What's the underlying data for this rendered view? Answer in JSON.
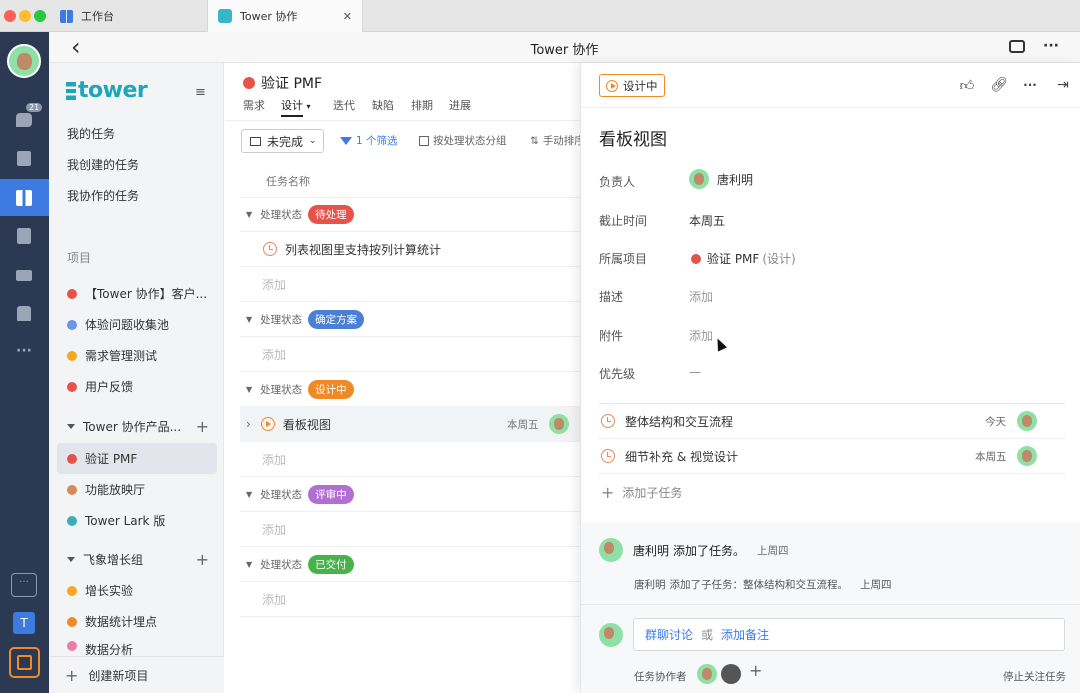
{
  "tabs": {
    "workspace": "工作台",
    "active": "Tower 协作",
    "close": "✕"
  },
  "titlebar": {
    "back": "‹",
    "title": "Tower 协作",
    "more": "···"
  },
  "rail": {
    "badge": "21"
  },
  "sidebar": {
    "logo": "tower",
    "my_tasks": "我的任务",
    "created_tasks": "我创建的任务",
    "collab_tasks": "我协作的任务",
    "projects_label": "项目",
    "projects": [
      {
        "label": "【Tower 协作】客户...",
        "color": "#e5534b"
      },
      {
        "label": "体验问题收集池",
        "color": "#6b95e6"
      },
      {
        "label": "需求管理测试",
        "color": "#f5a623"
      },
      {
        "label": "用户反馈",
        "color": "#e5534b"
      }
    ],
    "group1": {
      "label": "Tower 协作产品...",
      "items": [
        {
          "label": "验证 PMF",
          "color": "#e5534b"
        },
        {
          "label": "功能放映厅",
          "color": "#d98a5c"
        },
        {
          "label": "Tower Lark 版",
          "color": "#3ab0b6"
        }
      ]
    },
    "group2": {
      "label": "飞象增长组",
      "items": [
        {
          "label": "增长实验",
          "color": "#f5a623"
        },
        {
          "label": "数据统计埋点",
          "color": "#f08a24"
        },
        {
          "label": "数据分析",
          "color": "#ee7ba5"
        }
      ]
    },
    "create_project": "创建新项目"
  },
  "middle": {
    "project_title": "验证 PMF",
    "tabs": [
      "需求",
      "设计",
      "迭代",
      "缺陷",
      "排期",
      "进展"
    ],
    "filter_status": "未完成",
    "filter_count": "1 个筛选",
    "group_by": "按处理状态分组",
    "sort": "手动排序",
    "col_header": "任务名称",
    "group_prefix": "处理状态",
    "add": "添加",
    "groups": [
      {
        "badge": "待处理",
        "color": "#e5534b"
      },
      {
        "badge": "确定方案",
        "color": "#4b7fd6"
      },
      {
        "badge": "设计中",
        "color": "#f08a24"
      },
      {
        "badge": "评审中",
        "color": "#b26fd2"
      },
      {
        "badge": "已交付",
        "color": "#49b34b"
      }
    ],
    "task1": "列表视图里支持按列计算统计",
    "task2": "看板视图",
    "task2_due": "本周五"
  },
  "panel": {
    "status": "设计中",
    "title": "看板视图",
    "fields": {
      "assignee_label": "负责人",
      "assignee": "唐利明",
      "due_label": "截止时间",
      "due": "本周五",
      "project_label": "所属项目",
      "project": "验证 PMF",
      "project_sub": "(设计)",
      "desc_label": "描述",
      "desc": "添加",
      "attach_label": "附件",
      "attach": "添加",
      "priority_label": "优先级",
      "priority": "—"
    },
    "subtasks": [
      {
        "title": "整体结构和交互流程",
        "due": "今天"
      },
      {
        "title": "细节补充 & 视觉设计",
        "due": "本周五"
      }
    ],
    "add_subtask": "添加子任务",
    "activity1": {
      "user": "唐利明",
      "text": "添加了任务。",
      "time": "上周四"
    },
    "activity2": {
      "user": "唐利明",
      "text": "添加了子任务：整体结构和交互流程。",
      "time": "上周四"
    },
    "comment": {
      "discuss": "群聊讨论",
      "or": "或",
      "note": "添加备注"
    },
    "collaborators": "任务协作者",
    "unfollow": "停止关注任务"
  }
}
